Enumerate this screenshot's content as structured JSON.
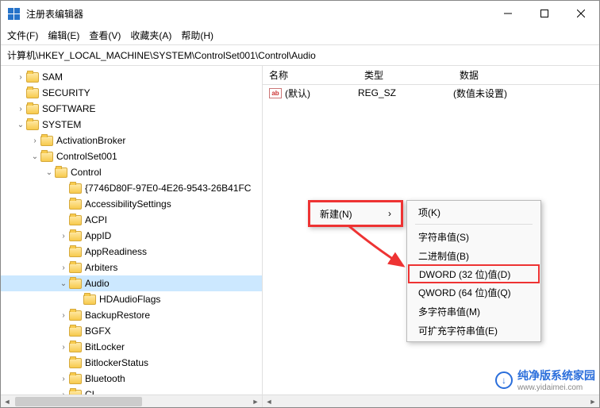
{
  "window": {
    "title": "注册表编辑器"
  },
  "menu": {
    "file": "文件(F)",
    "edit": "编辑(E)",
    "view": "查看(V)",
    "favorites": "收藏夹(A)",
    "help": "帮助(H)"
  },
  "address": "计算机\\HKEY_LOCAL_MACHINE\\SYSTEM\\ControlSet001\\Control\\Audio",
  "tree": [
    {
      "indent": 1,
      "chev": "closed",
      "label": "SAM"
    },
    {
      "indent": 1,
      "chev": "",
      "label": "SECURITY"
    },
    {
      "indent": 1,
      "chev": "closed",
      "label": "SOFTWARE"
    },
    {
      "indent": 1,
      "chev": "open",
      "label": "SYSTEM"
    },
    {
      "indent": 2,
      "chev": "closed",
      "label": "ActivationBroker"
    },
    {
      "indent": 2,
      "chev": "open",
      "label": "ControlSet001"
    },
    {
      "indent": 3,
      "chev": "open",
      "label": "Control"
    },
    {
      "indent": 4,
      "chev": "",
      "label": "{7746D80F-97E0-4E26-9543-26B41FC"
    },
    {
      "indent": 4,
      "chev": "",
      "label": "AccessibilitySettings"
    },
    {
      "indent": 4,
      "chev": "",
      "label": "ACPI"
    },
    {
      "indent": 4,
      "chev": "closed",
      "label": "AppID"
    },
    {
      "indent": 4,
      "chev": "",
      "label": "AppReadiness"
    },
    {
      "indent": 4,
      "chev": "closed",
      "label": "Arbiters"
    },
    {
      "indent": 4,
      "chev": "open",
      "label": "Audio",
      "selected": true
    },
    {
      "indent": 5,
      "chev": "",
      "label": "HDAudioFlags"
    },
    {
      "indent": 4,
      "chev": "closed",
      "label": "BackupRestore"
    },
    {
      "indent": 4,
      "chev": "",
      "label": "BGFX"
    },
    {
      "indent": 4,
      "chev": "closed",
      "label": "BitLocker"
    },
    {
      "indent": 4,
      "chev": "",
      "label": "BitlockerStatus"
    },
    {
      "indent": 4,
      "chev": "closed",
      "label": "Bluetooth"
    },
    {
      "indent": 4,
      "chev": "closed",
      "label": "CI"
    }
  ],
  "list": {
    "headers": {
      "name": "名称",
      "type": "类型",
      "data": "数据"
    },
    "rows": [
      {
        "icon": "ab",
        "name": "(默认)",
        "type": "REG_SZ",
        "data": "(数值未设置)"
      }
    ]
  },
  "ctx1": {
    "new": "新建(N)"
  },
  "ctx2": {
    "key": "项(K)",
    "string": "字符串值(S)",
    "binary": "二进制值(B)",
    "dword": "DWORD (32 位)值(D)",
    "qword": "QWORD (64 位)值(Q)",
    "multi": "多字符串值(M)",
    "expand": "可扩充字符串值(E)"
  },
  "watermark": {
    "name": "纯净版系统家园",
    "url": "www.yidaimei.com"
  }
}
